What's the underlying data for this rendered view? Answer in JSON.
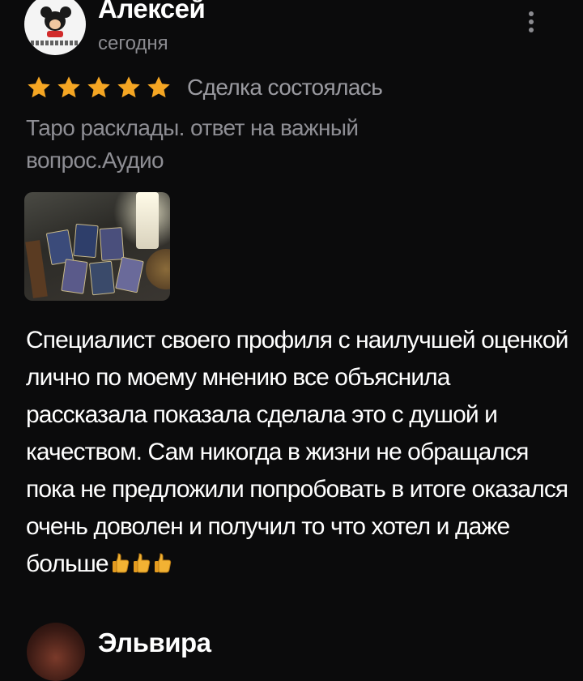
{
  "review": {
    "author": "Алексей",
    "date": "сегодня",
    "rating": 5,
    "rating_max": 5,
    "deal_status": "Сделка состоялась",
    "service_title": "Таро расклады. ответ на важный вопрос.Аудио",
    "photo_icon": "tarot-photo",
    "text": "Специалист своего профиля с наилучшей оценкой лично по моему мнению все объяснила рассказала показала сделала это с душой и качеством. Сам никогда в жизни не обращался пока не предложили попробовать в итоге оказался очень доволен и получил то что хотел и даже больше",
    "thumbs_up_count": 3
  },
  "next_review": {
    "author": "Эльвира"
  },
  "colors": {
    "background": "#0b0b0c",
    "star": "#f5a623",
    "muted_text": "#8e8e94",
    "primary_text": "#ffffff"
  },
  "icons": {
    "menu": "kebab-menu-icon",
    "star": "star-icon",
    "emoji": "thumbs-up-icon"
  }
}
